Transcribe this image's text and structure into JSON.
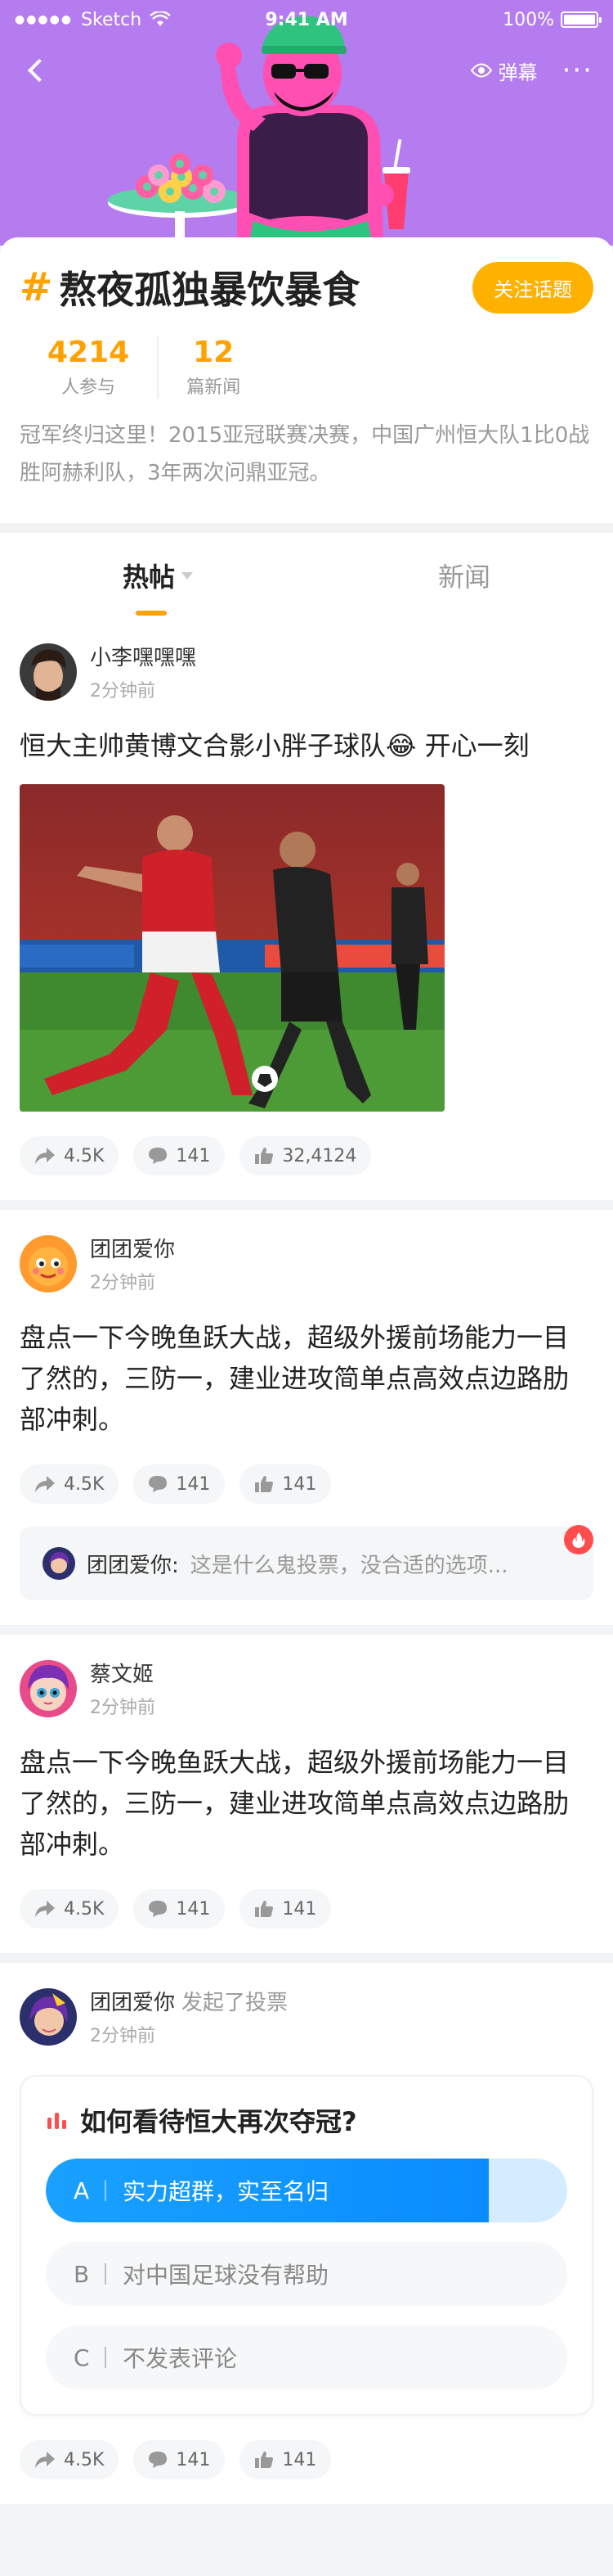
{
  "status_bar": {
    "carrier": "Sketch",
    "time": "9:41 AM",
    "battery_text": "100%",
    "battery_level": 1.0
  },
  "nav": {
    "danmu_label": "弹幕",
    "back_icon": "chevron-left-icon",
    "more_icon": "more-dots-icon"
  },
  "topic": {
    "hash": "#",
    "title": "熬夜孤独暴饮暴食",
    "follow_label": "关注话题",
    "stats": [
      {
        "num": "4214",
        "label": "人参与"
      },
      {
        "num": "12",
        "label": "篇新闻"
      }
    ],
    "description": "冠军终归这里！2015亚冠联赛决赛，中国广州恒大队1比0战胜阿赫利队，3年两次问鼎亚冠。"
  },
  "tabs": [
    {
      "label": "热帖"
    },
    {
      "label": "新闻"
    }
  ],
  "posts": [
    {
      "author": "小李嘿嘿嘿",
      "time": "2分钟前",
      "text": "恒大主帅黄博文合影小胖子球队😂 开心一刻",
      "share": "4.5K",
      "comments": "141",
      "likes": "32,4124"
    },
    {
      "author": "团团爱你",
      "time": "2分钟前",
      "text": "盘点一下今晚鱼跃大战，超级外援前场能力一目了然的，三防一，建业进攻简单点高效点边路肋部冲刺。",
      "share": "4.5K",
      "comments": "141",
      "likes": "141",
      "comment_preview": {
        "name": "团团爱你:",
        "text": "这是什么鬼投票，没合适的选项..."
      }
    },
    {
      "author": "蔡文姬",
      "time": "2分钟前",
      "text": "盘点一下今晚鱼跃大战，超级外援前场能力一目了然的，三防一，建业进攻简单点高效点边路肋部冲刺。",
      "share": "4.5K",
      "comments": "141",
      "likes": "141"
    },
    {
      "author": "团团爱你",
      "action": "发起了投票",
      "time": "2分钟前",
      "share": "4.5K",
      "comments": "141",
      "likes": "141"
    }
  ],
  "poll": {
    "title": "如何看待恒大再次夺冠?",
    "options": [
      {
        "letter": "A",
        "text": "实力超群，实至名归",
        "selected": true,
        "fraction": 0.85
      },
      {
        "letter": "B",
        "text": "对中国足球没有帮助",
        "selected": false
      },
      {
        "letter": "C",
        "text": "不发表评论",
        "selected": false
      }
    ]
  },
  "colors": {
    "accent": "#ffa200",
    "hero_bg": "#b57cf0",
    "poll_blue": "#1aa1ff"
  }
}
